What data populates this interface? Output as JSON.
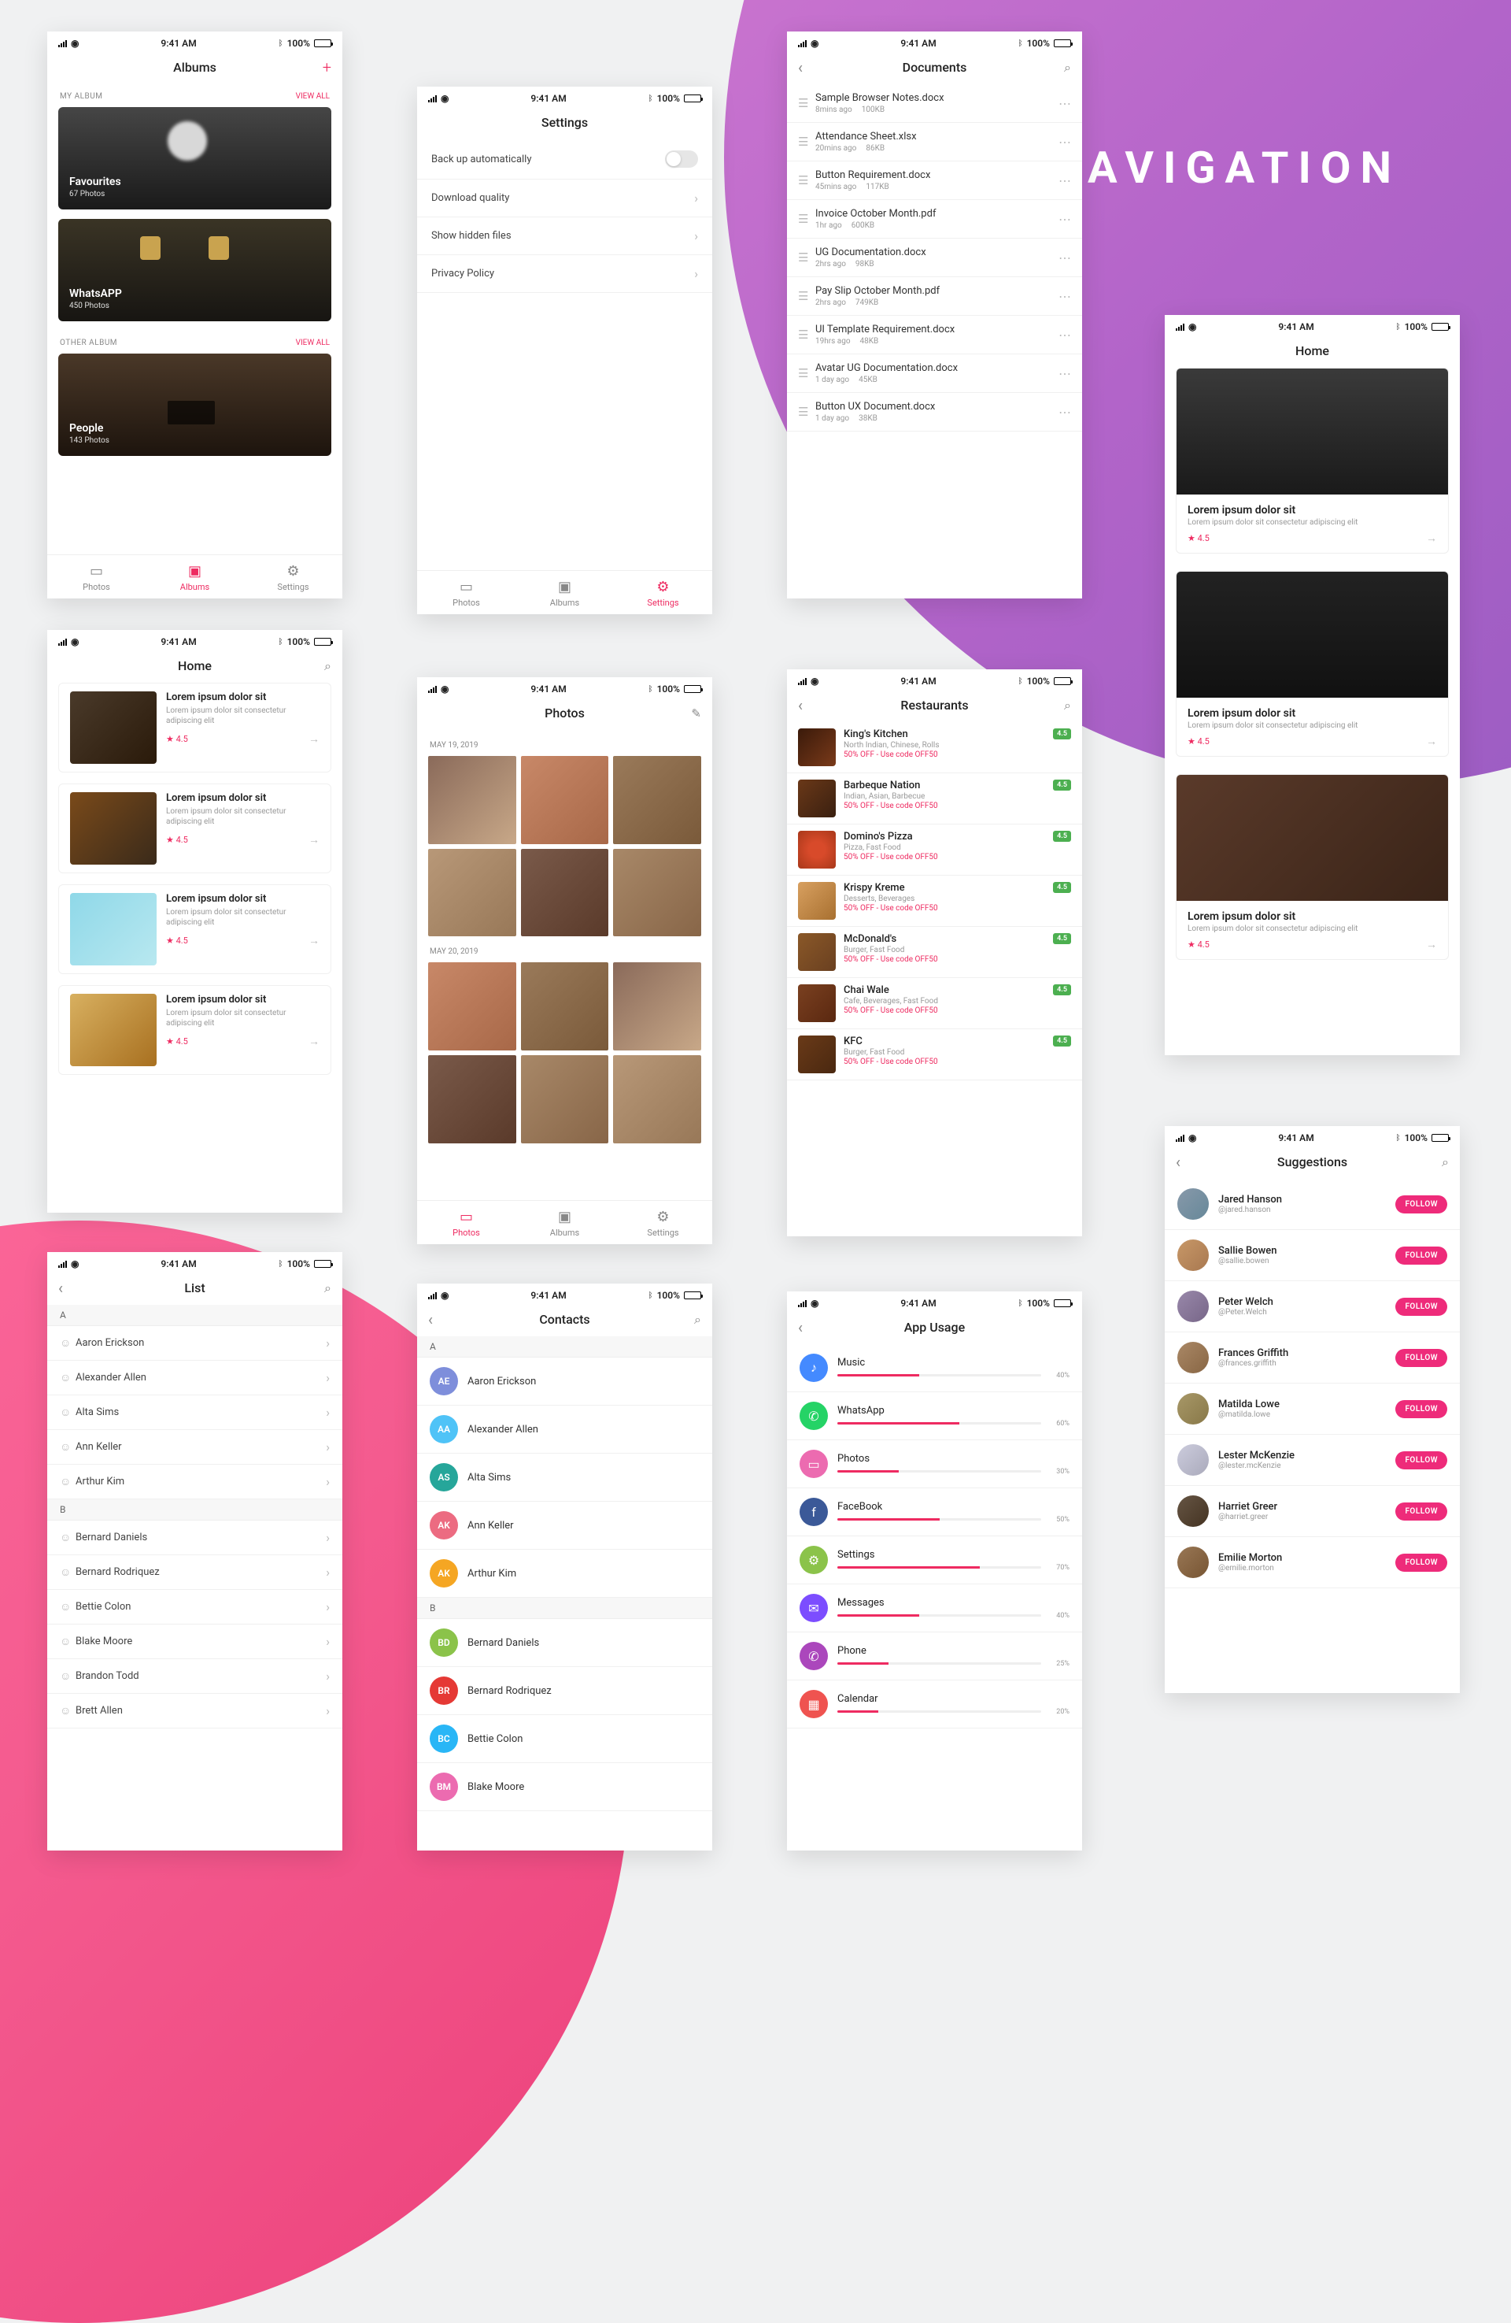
{
  "section_heading": "NAVIGATION",
  "status": {
    "time": "9:41 AM",
    "battery": "100%"
  },
  "tabbar": {
    "photos": "Photos",
    "albums": "Albums",
    "settings": "Settings"
  },
  "albums": {
    "title": "Albums",
    "my_album_label": "MY ALBUM",
    "other_album_label": "OTHER ALBUM",
    "view_all": "VIEW ALL",
    "cards": [
      {
        "title": "Favourites",
        "subtitle": "67 Photos"
      },
      {
        "title": "WhatsAPP",
        "subtitle": "450 Photos"
      },
      {
        "title": "People",
        "subtitle": "143 Photos"
      }
    ]
  },
  "settings": {
    "title": "Settings",
    "rows": {
      "backup": "Back up automatically",
      "download": "Download  quality",
      "hidden": "Show hidden files",
      "privacy": "Privacy Policy"
    }
  },
  "documents": {
    "title": "Documents",
    "items": [
      {
        "name": "Sample Browser Notes.docx",
        "time": "8mins ago",
        "size": "100KB"
      },
      {
        "name": "Attendance Sheet.xlsx",
        "time": "20mins ago",
        "size": "86KB"
      },
      {
        "name": "Button Requirement.docx",
        "time": "45mins ago",
        "size": "117KB"
      },
      {
        "name": "Invoice October Month.pdf",
        "time": "1hr ago",
        "size": "600KB"
      },
      {
        "name": "UG Documentation.docx",
        "time": "2hrs ago",
        "size": "98KB"
      },
      {
        "name": "Pay Slip October Month.pdf",
        "time": "2hrs ago",
        "size": "749KB"
      },
      {
        "name": "UI Template Requirement.docx",
        "time": "19hrs ago",
        "size": "48KB"
      },
      {
        "name": "Avatar UG Documentation.docx",
        "time": "1 day ago",
        "size": "45KB"
      },
      {
        "name": "Button UX Document.docx",
        "time": "1 day ago",
        "size": "38KB"
      }
    ]
  },
  "home_thumbs": {
    "title": "Home",
    "row_title": "Lorem ipsum dolor sit",
    "row_sub": "Lorem ipsum dolor sit consectetur adipiscing elit",
    "rating": "4.5"
  },
  "home_big": {
    "title": "Home",
    "card_title": "Lorem ipsum dolor sit",
    "card_sub": "Lorem ipsum dolor sit consectetur adipiscing elit",
    "rating": "4.5"
  },
  "photos": {
    "title": "Photos",
    "date1": "MAY 19, 2019",
    "date2": "MAY 20, 2019"
  },
  "restaurants": {
    "title": "Restaurants",
    "badge": "4.5",
    "promo": "50% OFF - Use code OFF50",
    "items": [
      {
        "name": "King's Kitchen",
        "sub": "North Indian, Chinese, Rolls"
      },
      {
        "name": "Barbeque Nation",
        "sub": "Indian, Asian, Barbecue"
      },
      {
        "name": "Domino's Pizza",
        "sub": "Pizza, Fast Food"
      },
      {
        "name": "Krispy Kreme",
        "sub": "Desserts, Beverages"
      },
      {
        "name": "McDonald's",
        "sub": "Burger, Fast Food"
      },
      {
        "name": "Chai Wale",
        "sub": "Cafe, Beverages, Fast Food"
      },
      {
        "name": "KFC",
        "sub": "Burger, Fast Food"
      }
    ]
  },
  "suggestions": {
    "title": "Suggestions",
    "follow": "FOLLOW",
    "items": [
      {
        "name": "Jared Hanson",
        "handle": "@jared.hanson"
      },
      {
        "name": "Sallie Bowen",
        "handle": "@sallie.bowen"
      },
      {
        "name": "Peter Welch",
        "handle": "@Peter.Welch"
      },
      {
        "name": "Frances Griffith",
        "handle": "@frances.griffith"
      },
      {
        "name": "Matilda Lowe",
        "handle": "@matilda.lowe"
      },
      {
        "name": "Lester McKenzie",
        "handle": "@lester.mcKenzie"
      },
      {
        "name": "Harriet Greer",
        "handle": "@harriet.greer"
      },
      {
        "name": "Emilie Morton",
        "handle": "@emilie.morton"
      }
    ]
  },
  "list": {
    "title": "List",
    "A": [
      "Aaron Erickson",
      "Alexander Allen",
      "Alta Sims",
      "Ann Keller",
      "Arthur Kim"
    ],
    "B": [
      "Bernard Daniels",
      "Bernard Rodriquez",
      "Bettie Colon",
      "Blake Moore",
      "Brandon Todd",
      "Brett Allen"
    ]
  },
  "contacts": {
    "title": "Contacts",
    "A": [
      {
        "init": "AE",
        "name": "Aaron Erickson",
        "color": "#7e8edb"
      },
      {
        "init": "AA",
        "name": "Alexander Allen",
        "color": "#4fc3f7"
      },
      {
        "init": "AS",
        "name": "Alta Sims",
        "color": "#26a69a"
      },
      {
        "init": "AK",
        "name": "Ann Keller",
        "color": "#ec6b81"
      },
      {
        "init": "AK",
        "name": "Arthur Kim",
        "color": "#f5a623"
      }
    ],
    "B": [
      {
        "init": "BD",
        "name": "Bernard Daniels",
        "color": "#8bc34a"
      },
      {
        "init": "BR",
        "name": "Bernard Rodriquez",
        "color": "#e53935"
      },
      {
        "init": "BC",
        "name": "Bettie Colon",
        "color": "#29b6f6"
      },
      {
        "init": "BM",
        "name": "Blake Moore",
        "color": "#ec6bb0"
      }
    ]
  },
  "usage": {
    "title": "App Usage",
    "items": [
      {
        "name": "Music",
        "pct": 40,
        "color": "#448aff",
        "glyph": "♪"
      },
      {
        "name": "WhatsApp",
        "pct": 60,
        "color": "#25d366",
        "glyph": "✆"
      },
      {
        "name": "Photos",
        "pct": 30,
        "color": "#ec6bb0",
        "glyph": "▭"
      },
      {
        "name": "FaceBook",
        "pct": 50,
        "color": "#3b5998",
        "glyph": "f"
      },
      {
        "name": "Settings",
        "pct": 70,
        "color": "#8bc34a",
        "glyph": "⚙"
      },
      {
        "name": "Messages",
        "pct": 40,
        "color": "#7c4dff",
        "glyph": "✉"
      },
      {
        "name": "Phone",
        "pct": 25,
        "color": "#ab47bc",
        "glyph": "✆"
      },
      {
        "name": "Calendar",
        "pct": 20,
        "color": "#ef5350",
        "glyph": "▦"
      }
    ]
  }
}
